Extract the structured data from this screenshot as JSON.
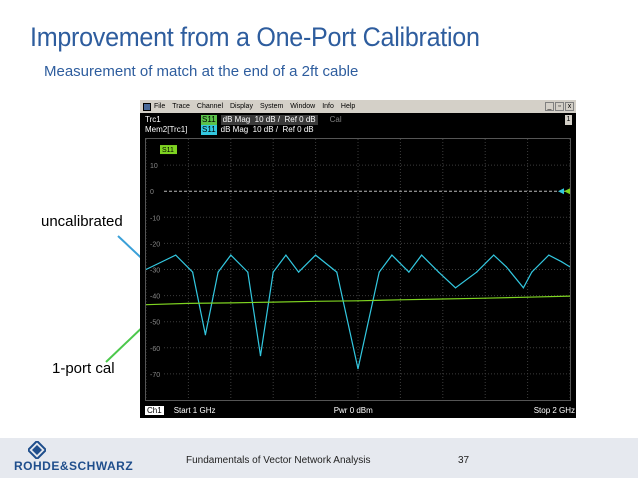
{
  "slide": {
    "title": "Improvement from a One-Port Calibration",
    "subtitle": "Measurement of match at the end of a 2ft cable",
    "annotation_uncal": "uncalibrated",
    "annotation_cal": "1-port cal",
    "footer_text": "Fundamentals of Vector Network Analysis",
    "page_number": "37",
    "logo_text": "ROHDE&SCHWARZ",
    "colors": {
      "title": "#2e5d9e",
      "arrow": "#3aa0d8",
      "arrow_green": "#4cc84c"
    }
  },
  "vna": {
    "menu": [
      "File",
      "Trace",
      "Channel",
      "Display",
      "System",
      "Window",
      "Info",
      "Help"
    ],
    "window_buttons": [
      "_",
      "▫",
      "x"
    ],
    "trace1": {
      "name": "Trc1",
      "param": "S11",
      "format": "dB Mag",
      "scale": "10 dB /",
      "ref": "Ref 0 dB",
      "cal": "Cal"
    },
    "trace2": {
      "name": "Mem2[Trc1]",
      "param": "S11",
      "format": "dB Mag",
      "scale": "10 dB /",
      "ref": "Ref 0 dB"
    },
    "scroll_label": "1",
    "status": {
      "channel": "Ch1",
      "start": "Start  1 GHz",
      "power": "Pwr  0 dBm",
      "stop": "Stop  2 GHz"
    },
    "colors": {
      "uncal": "#33c8e0",
      "cal": "#7ed321",
      "grid": "#3c3c3c"
    }
  },
  "chart_data": {
    "type": "line",
    "marker_label": "S11",
    "xlim": [
      1,
      2
    ],
    "ylim": [
      -80,
      20
    ],
    "y_ticks": [
      10,
      0,
      -10,
      -20,
      -30,
      -40,
      -50,
      -60,
      -70
    ],
    "y_tick_labels": [
      "10",
      "0",
      "-10",
      "-20",
      "-30",
      "-40",
      "-50",
      "-60",
      "-70"
    ],
    "reference_line": 0,
    "series": [
      {
        "color": "#33c8e0",
        "x": [
          1.0,
          1.07,
          1.11,
          1.14,
          1.17,
          1.2,
          1.24,
          1.27,
          1.3,
          1.33,
          1.36,
          1.4,
          1.45,
          1.5,
          1.55,
          1.58,
          1.62,
          1.65,
          1.69,
          1.73,
          1.78,
          1.82,
          1.85,
          1.89,
          1.91,
          1.95,
          1.98,
          2.0
        ],
        "y": [
          -30,
          -24.5,
          -31,
          -55,
          -31,
          -24.5,
          -31,
          -63,
          -31,
          -24.5,
          -31,
          -24.5,
          -31,
          -68,
          -31,
          -24.5,
          -31,
          -24.5,
          -31,
          -37,
          -31,
          -24.5,
          -29,
          -37,
          -31,
          -24.5,
          -27,
          -29
        ]
      },
      {
        "color": "#7ed321",
        "x": [
          1.0,
          1.1,
          1.2,
          1.3,
          1.4,
          1.5,
          1.6,
          1.7,
          1.8,
          1.9,
          2.0
        ],
        "y": [
          -43.5,
          -43,
          -42.8,
          -42.5,
          -42.2,
          -42.0,
          -41.6,
          -41.3,
          -41.0,
          -40.6,
          -40.2
        ]
      }
    ]
  }
}
